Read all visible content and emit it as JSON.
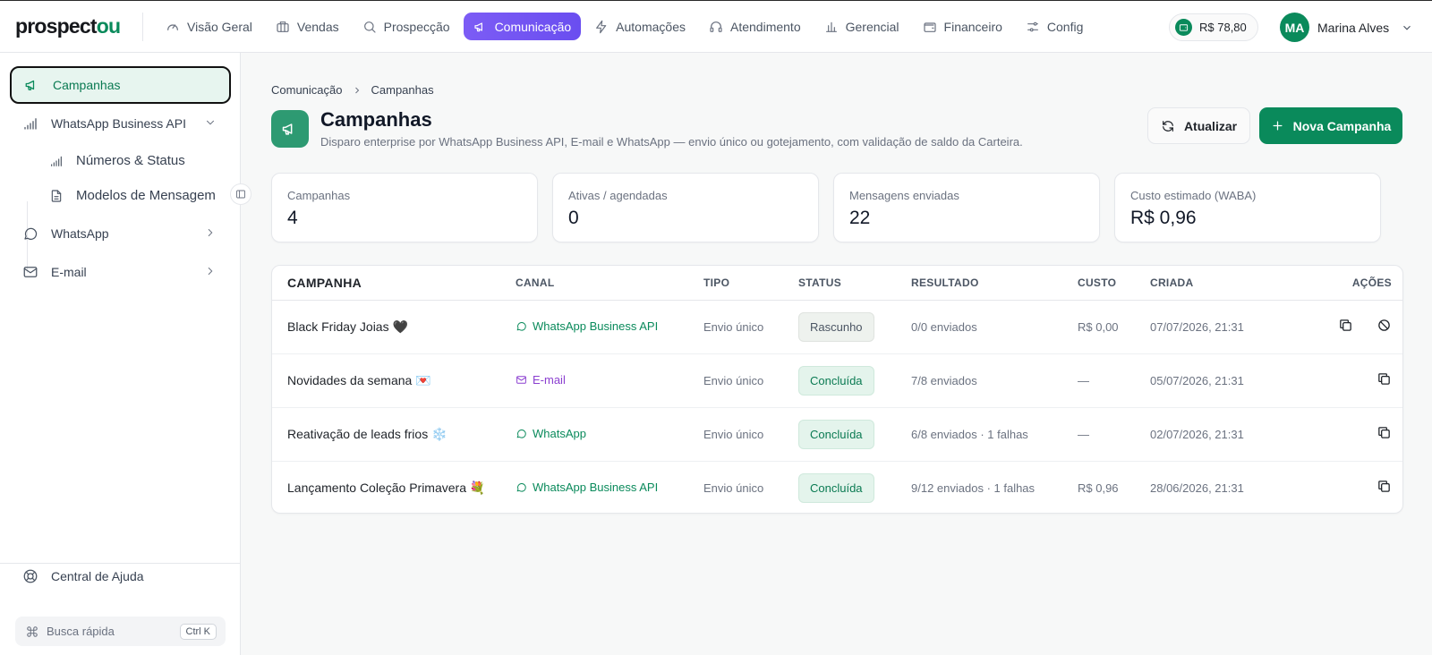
{
  "brand": {
    "prefix": "prospect",
    "suffix": "ou"
  },
  "nav": [
    {
      "label": "Visão Geral",
      "icon": "gauge-icon"
    },
    {
      "label": "Vendas",
      "icon": "briefcase-icon"
    },
    {
      "label": "Prospecção",
      "icon": "search-icon"
    },
    {
      "label": "Comunicação",
      "icon": "megaphone-icon",
      "active": true
    },
    {
      "label": "Automações",
      "icon": "zap-icon"
    },
    {
      "label": "Atendimento",
      "icon": "headset-icon"
    },
    {
      "label": "Gerencial",
      "icon": "bar-chart-icon"
    },
    {
      "label": "Financeiro",
      "icon": "wallet-icon"
    },
    {
      "label": "Config",
      "icon": "sliders-icon"
    }
  ],
  "wallet": {
    "balance": "R$ 78,80"
  },
  "user": {
    "initials": "MA",
    "name": "Marina Alves"
  },
  "sidebar": {
    "items": [
      {
        "label": "Campanhas",
        "icon": "megaphone-icon",
        "active": true
      },
      {
        "label": "WhatsApp Business API",
        "icon": "signal-icon",
        "expanded": true
      },
      {
        "label": "Números & Status",
        "icon": "signal-icon"
      },
      {
        "label": "Modelos de Mensagem",
        "icon": "file-text-icon"
      },
      {
        "label": "WhatsApp",
        "icon": "message-circle-icon"
      },
      {
        "label": "E-mail",
        "icon": "mail-icon"
      }
    ],
    "help": "Central de Ajuda",
    "quick_search": {
      "label": "Busca rápida",
      "shortcut": "Ctrl K"
    }
  },
  "breadcrumb": [
    "Comunicação",
    "Campanhas"
  ],
  "header": {
    "title": "Campanhas",
    "subtitle": "Disparo enterprise por WhatsApp Business API, E-mail e WhatsApp — envio único ou gotejamento, com validação de saldo da Carteira.",
    "refresh_label": "Atualizar",
    "new_label": "Nova Campanha"
  },
  "stats": [
    {
      "label": "Campanhas",
      "value": "4"
    },
    {
      "label": "Ativas / agendadas",
      "value": "0"
    },
    {
      "label": "Mensagens enviadas",
      "value": "22"
    },
    {
      "label": "Custo estimado (WABA)",
      "value": "R$ 0,96"
    }
  ],
  "table": {
    "columns": [
      "CAMPANHA",
      "CANAL",
      "TIPO",
      "STATUS",
      "RESULTADO",
      "CUSTO",
      "CRIADA",
      "AÇÕES"
    ],
    "rows": [
      {
        "name": "Black Friday Joias 🖤",
        "channel": "WhatsApp Business API",
        "channel_icon": "message-circle-icon",
        "channel_color": "#0a8a5b",
        "type": "Envio único",
        "status": "Rascunho",
        "status_kind": "draft",
        "result": "0/0 enviados",
        "cost": "R$ 0,00",
        "created": "07/07/2026, 21:31",
        "actions": [
          "copy-icon",
          "ban-icon"
        ]
      },
      {
        "name": "Novidades da semana 💌",
        "channel": "E-mail",
        "channel_icon": "mail-icon",
        "channel_color": "#8b3fd0",
        "type": "Envio único",
        "status": "Concluída",
        "status_kind": "done",
        "result": "7/8 enviados",
        "cost": "—",
        "created": "05/07/2026, 21:31",
        "actions": [
          "copy-icon"
        ]
      },
      {
        "name": "Reativação de leads frios ❄️",
        "channel": "WhatsApp",
        "channel_icon": "message-circle-icon",
        "channel_color": "#0a8a5b",
        "type": "Envio único",
        "status": "Concluída",
        "status_kind": "done",
        "result": "6/8 enviados · 1 falhas",
        "cost": "—",
        "created": "02/07/2026, 21:31",
        "actions": [
          "copy-icon"
        ]
      },
      {
        "name": "Lançamento Coleção Primavera 💐",
        "channel": "WhatsApp Business API",
        "channel_icon": "message-circle-icon",
        "channel_color": "#0a8a5b",
        "type": "Envio único",
        "status": "Concluída",
        "status_kind": "done",
        "result": "9/12 enviados · 1 falhas",
        "cost": "R$ 0,96",
        "created": "28/06/2026, 21:31",
        "actions": [
          "copy-icon"
        ]
      }
    ]
  }
}
